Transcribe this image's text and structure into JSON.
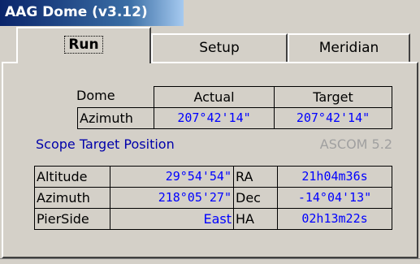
{
  "window": {
    "title": "AAG Dome (v3.12)"
  },
  "tabs": [
    {
      "label": "Run",
      "active": true
    },
    {
      "label": "Setup",
      "active": false
    },
    {
      "label": "Meridian",
      "active": false
    }
  ],
  "dome": {
    "header_label": "Dome",
    "col_actual": "Actual",
    "col_target": "Target",
    "row_label": "Azimuth",
    "actual_value": "207°42'14\"",
    "target_value": "207°42'14\""
  },
  "scope": {
    "section_title": "Scope Target Position",
    "driver_label": "ASCOM  5.2",
    "rows": [
      {
        "label": "Altitude",
        "value": "29°54'54\"",
        "label2": "RA",
        "value2": "21h04m36s"
      },
      {
        "label": "Azimuth",
        "value": "218°05'27\"",
        "label2": "Dec",
        "value2": "-14°04'13\""
      },
      {
        "label": "PierSide",
        "value": "East",
        "label2": "HA",
        "value2": "02h13m22s"
      }
    ]
  },
  "colors": {
    "title_bar": "#0a246a",
    "value_text": "#0000ff",
    "section_text": "#0000aa",
    "disabled_text": "#a0a0a0",
    "face": "#d4d0c8"
  }
}
